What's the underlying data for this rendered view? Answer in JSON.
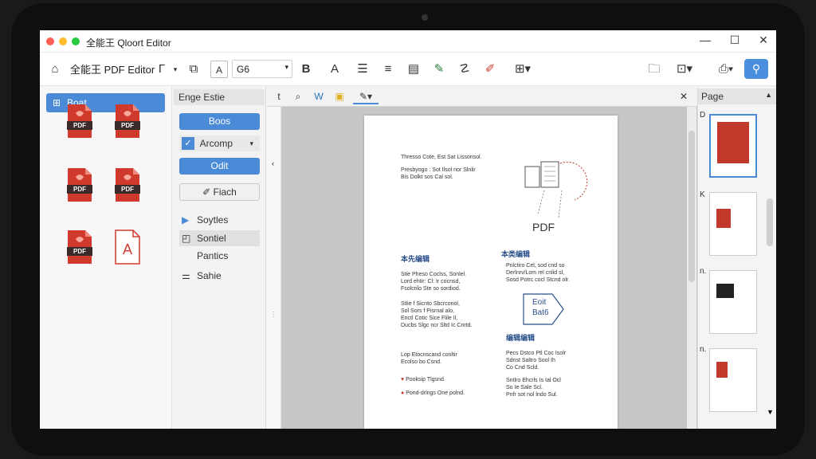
{
  "window": {
    "title": "全能王 Qloort Editor",
    "controls": [
      "—",
      "☐",
      "✕"
    ]
  },
  "toolbar": {
    "app_title": "全能王 PDF Editor",
    "font_size": "G6",
    "bold_label": "B",
    "font_label": "A"
  },
  "left_panel": {
    "header_button": "Boat",
    "files": [
      "PDF",
      "PDF",
      "PDF",
      "PDF",
      "PDF",
      "A"
    ]
  },
  "middle_panel": {
    "header": "Enge Estie",
    "btn1": "Boos",
    "dropdown": "Arcomp",
    "btn2": "Odit",
    "btn3": "Fiach",
    "list": [
      "Soytles",
      "Sontiel",
      "Pantics",
      "Sahie"
    ]
  },
  "doc_tabs": {
    "close": "✕"
  },
  "page_content": {
    "intro1": "Thresso Cote, Est Sat Lissonsol.",
    "intro2": "Presbyogo : Sot Ilsol nor Slnlir",
    "intro3": "Bis Dolkt sos Cal sol.",
    "figure_label": "PDF",
    "section1": "本先编辑",
    "section1_p1": "Stie Pheso Coclss, Sonlel.\nLord ehtir: Cl: Ir cocnsd,\nFsolcrilo Ste so sordiod.",
    "section1_p2": "Stlie f Sicnto Sbcrconol,\nSol Sors f Pisrnal alo,\nEnctl Cotic Sice Flile Il,\nDucbs Slgc ncr Sltd Ic Cnrtd.",
    "section1_p3": "Lop Etocnscand conltir\nEcolso bo Csnd.",
    "bullet1": "Pooksip Tlgsnd.",
    "bullet2": "Pond-drlngs One polnd.",
    "section2": "本类编辑",
    "section2_p1": "Pnlctiro Cel, sod cnd so\nDerlnrv/Lom rel cnlid sl,\nSosd Potrc cocl Stcnd olr.",
    "callout": "Eoit\nBat6",
    "section3": "编辑编辑",
    "section3_p1": "Pecs Dstco Ptl Coc Isolr\nSdnst Saltro Sool Ih\nCo Cnd Scld.",
    "section3_p2": "Sntlro Ehcrls Is Ial Ocl\nSo Ie Sale Scl.\nPnfr sot nol lndo Sul."
  },
  "right_panel": {
    "header": "Page",
    "thumb_labels": [
      "D",
      "K",
      "n.",
      "n."
    ]
  },
  "colors": {
    "accent": "#4b8ad6",
    "pdf_red": "#d03a2d",
    "heading_blue": "#2a4f8a"
  }
}
